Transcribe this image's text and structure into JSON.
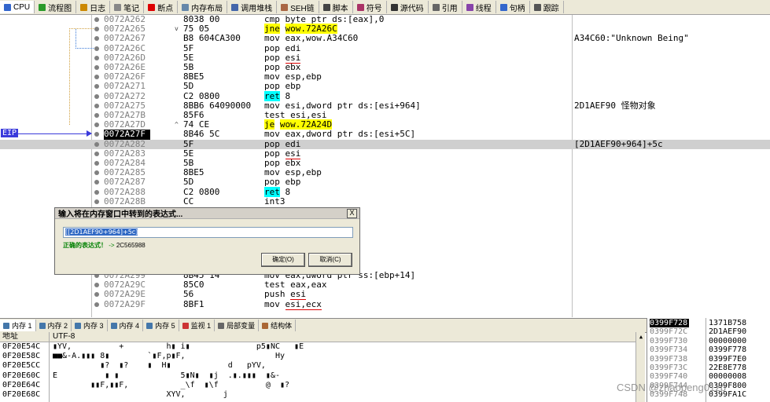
{
  "toolbar": {
    "tabs": [
      {
        "label": "CPU",
        "icon": "cpu-icon",
        "color": "#3366cc"
      },
      {
        "label": "流程图",
        "icon": "graph-icon",
        "color": "#2a9a2a"
      },
      {
        "label": "日志",
        "icon": "log-icon",
        "color": "#cc8800"
      },
      {
        "label": "笔记",
        "icon": "note-icon",
        "color": "#888888"
      },
      {
        "label": "断点",
        "icon": "breakpoint-icon",
        "color": "#dd0000"
      },
      {
        "label": "内存布局",
        "icon": "memory-map-icon",
        "color": "#6688aa"
      },
      {
        "label": "调用堆栈",
        "icon": "call-stack-icon",
        "color": "#4466aa"
      },
      {
        "label": "SEH链",
        "icon": "seh-icon",
        "color": "#aa6644"
      },
      {
        "label": "脚本",
        "icon": "script-icon",
        "color": "#444444"
      },
      {
        "label": "符号",
        "icon": "symbol-icon",
        "color": "#aa3366"
      },
      {
        "label": "源代码",
        "icon": "source-icon",
        "color": "#333333"
      },
      {
        "label": "引用",
        "icon": "reference-icon",
        "color": "#666666"
      },
      {
        "label": "线程",
        "icon": "thread-icon",
        "color": "#8844aa"
      },
      {
        "label": "句柄",
        "icon": "handle-icon",
        "color": "#3366cc"
      },
      {
        "label": "跟踪",
        "icon": "trace-icon",
        "color": "#555555"
      }
    ]
  },
  "eip_label": "EIP",
  "disasm": [
    {
      "addr": "0072A262",
      "arr": "",
      "bytes": "8038 00",
      "mn": "cmp",
      "op": "byte ptr ds:[eax],0",
      "cmt": ""
    },
    {
      "addr": "0072A265",
      "arr": "v",
      "bytes": "75 05",
      "mn": "jne",
      "op": "wow.72A26C",
      "cmt": "",
      "hl": "y"
    },
    {
      "addr": "0072A267",
      "arr": "",
      "bytes": "B8 604CA300",
      "mn": "mov",
      "op": "eax,wow.A34C60",
      "cmt": "A34C60:\"Unknown Being\""
    },
    {
      "addr": "0072A26C",
      "arr": "",
      "bytes": "5F",
      "mn": "pop",
      "op": "edi",
      "cmt": ""
    },
    {
      "addr": "0072A26D",
      "arr": "",
      "bytes": "5E",
      "mn": "pop",
      "op": "esi",
      "cmt": "",
      "ul": true
    },
    {
      "addr": "0072A26E",
      "arr": "",
      "bytes": "5B",
      "mn": "pop",
      "op": "ebx",
      "cmt": ""
    },
    {
      "addr": "0072A26F",
      "arr": "",
      "bytes": "8BE5",
      "mn": "mov",
      "op": "esp,ebp",
      "cmt": ""
    },
    {
      "addr": "0072A271",
      "arr": "",
      "bytes": "5D",
      "mn": "pop",
      "op": "ebp",
      "cmt": ""
    },
    {
      "addr": "0072A272",
      "arr": "",
      "bytes": "C2 0800",
      "mn": "ret",
      "op": "8",
      "cmt": "",
      "hl": "c"
    },
    {
      "addr": "0072A275",
      "arr": "",
      "bytes": "8BB6 64090000",
      "mn": "mov",
      "op": "esi,dword ptr ds:[esi+964]",
      "cmt": "2D1AEF90 怪物对象"
    },
    {
      "addr": "0072A27B",
      "arr": "",
      "bytes": "85F6",
      "mn": "test",
      "op": "esi,esi",
      "cmt": ""
    },
    {
      "addr": "0072A27D",
      "arr": "^",
      "bytes": "74 CE",
      "mn": "je",
      "op": "wow.72A24D",
      "cmt": "",
      "hl": "y"
    },
    {
      "addr": "0072A27F",
      "arr": "",
      "bytes": "8B46 5C",
      "mn": "mov",
      "op": "eax,dword ptr ds:[esi+5C]",
      "cmt": "",
      "eip": true
    },
    {
      "addr": "0072A282",
      "arr": "",
      "bytes": "5F",
      "mn": "pop",
      "op": "edi",
      "cmt": "[2D1AEF90+964]+5c",
      "sel": true
    },
    {
      "addr": "0072A283",
      "arr": "",
      "bytes": "5E",
      "mn": "pop",
      "op": "esi",
      "cmt": "",
      "ul": true
    },
    {
      "addr": "0072A284",
      "arr": "",
      "bytes": "5B",
      "mn": "pop",
      "op": "ebx",
      "cmt": ""
    },
    {
      "addr": "0072A285",
      "arr": "",
      "bytes": "8BE5",
      "mn": "mov",
      "op": "esp,ebp",
      "cmt": ""
    },
    {
      "addr": "0072A287",
      "arr": "",
      "bytes": "5D",
      "mn": "pop",
      "op": "ebp",
      "cmt": ""
    },
    {
      "addr": "0072A288",
      "arr": "",
      "bytes": "C2 0800",
      "mn": "ret",
      "op": "8",
      "cmt": "",
      "hl": "c"
    },
    {
      "addr": "0072A28B",
      "arr": "",
      "bytes": "CC",
      "mn": "int3",
      "op": "",
      "cmt": ""
    }
  ],
  "disasm_lower": [
    {
      "addr": "0072A299",
      "arr": "",
      "bytes": "8B45 14",
      "mn": "mov",
      "op": "eax,dword ptr ss:[ebp+14]",
      "cmt": ""
    },
    {
      "addr": "0072A29C",
      "arr": "",
      "bytes": "85C0",
      "mn": "test",
      "op": "eax,eax",
      "cmt": ""
    },
    {
      "addr": "0072A29E",
      "arr": "",
      "bytes": "56",
      "mn": "push",
      "op": "esi",
      "cmt": "",
      "ul": true
    },
    {
      "addr": "0072A29F",
      "arr": "",
      "bytes": "8BF1",
      "mn": "mov",
      "op": "esi,ecx",
      "cmt": "",
      "ul": true
    }
  ],
  "dialog": {
    "title": "输入将在内存窗口中转到的表达式...",
    "close": "X",
    "expression": "[[2D1AEF90+964]+5c]",
    "result_label": "正确的表达式！",
    "result_arrow": "->",
    "result_value": "2C565988",
    "ok_label": "确定(O)",
    "cancel_label": "取消(C)"
  },
  "bottom_tabs": [
    {
      "label": "内存 1",
      "active": true
    },
    {
      "label": "内存 2"
    },
    {
      "label": "内存 3"
    },
    {
      "label": "内存 4"
    },
    {
      "label": "内存 5"
    },
    {
      "label": "监视 1"
    },
    {
      "label": "局部变量"
    },
    {
      "label": "结构体"
    }
  ],
  "dump": {
    "col_addr": "地址",
    "col_text": "UTF-8",
    "rows": [
      {
        "addr": "0F20E54C",
        "text": "▮YV,          +         h▮ i▮              p5▮NC   ▮E"
      },
      {
        "addr": "0F20E58C",
        "text": "■■&-A.▮▮▮ 8▮        `▮F,p▮F,                   Hy"
      },
      {
        "addr": "0F20E5CC",
        "text": "          ▮?  ▮?    ▮  H▮            d   pYV,"
      },
      {
        "addr": "0F20E60C",
        "text": "E          ▮ ▮             5▮N▮  ▮j  .▮.▮▮▮  ▮&-"
      },
      {
        "addr": "0F20E64C",
        "text": "        ▮▮F,▮▮F,           _\\f  ▮\\f          @  ▮?"
      },
      {
        "addr": "0F20E68C",
        "text": "                        XYV,        j"
      }
    ]
  },
  "stack": [
    {
      "addr": "0399F728",
      "val": "1371B758"
    },
    {
      "addr": "0399F72C",
      "val": "2D1AEF90"
    },
    {
      "addr": "0399F730",
      "val": "00000000"
    },
    {
      "addr": "0399F734",
      "val": "0399F778"
    },
    {
      "addr": "0399F738",
      "val": "0399F7E0"
    },
    {
      "addr": "0399F73C",
      "val": "22E8E778"
    },
    {
      "addr": "0399F740",
      "val": "00000008"
    },
    {
      "addr": "0399F744",
      "val": "0399F800"
    },
    {
      "addr": "0399F748",
      "val": "0399FA1C"
    }
  ],
  "watermark": "CSDN @zhaopeng01zp"
}
